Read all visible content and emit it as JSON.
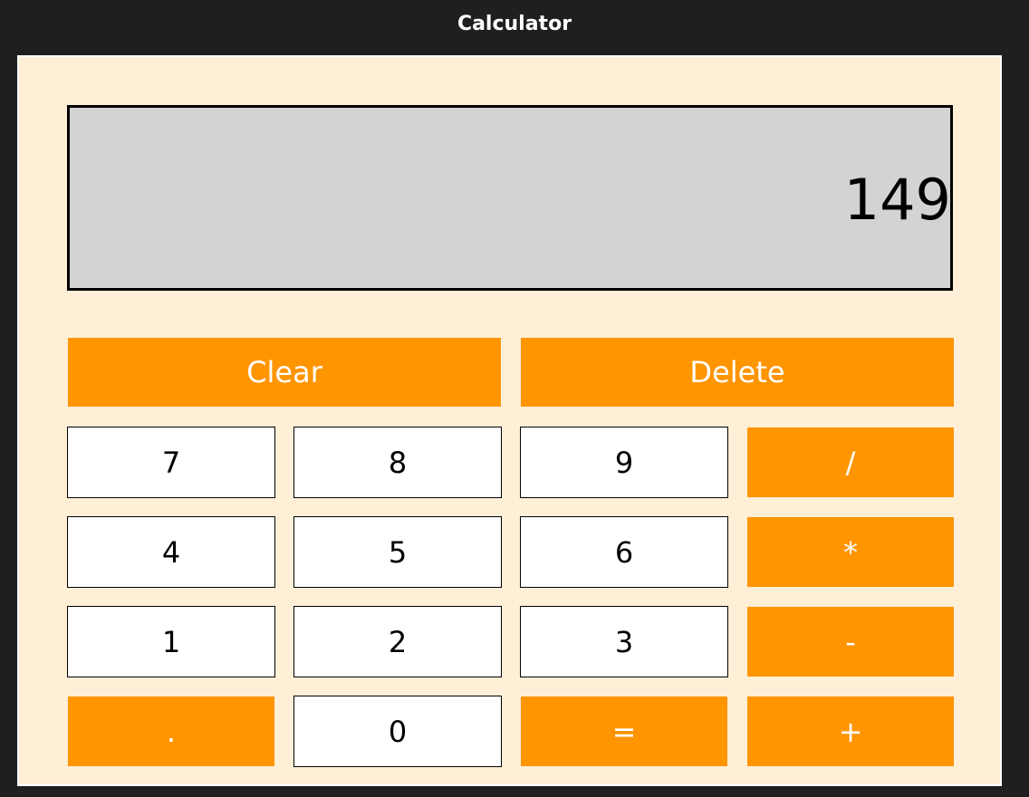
{
  "window": {
    "title": "Calculator"
  },
  "display": {
    "value": "149"
  },
  "colors": {
    "accent": "#ff9500",
    "background": "#ffefd6",
    "display_bg": "#d3d3d3",
    "titlebar_bg": "#1f1f1f"
  },
  "keys": {
    "clear": "Clear",
    "delete": "Delete",
    "seven": "7",
    "eight": "8",
    "nine": "9",
    "divide": "/",
    "four": "4",
    "five": "5",
    "six": "6",
    "multiply": "*",
    "one": "1",
    "two": "2",
    "three": "3",
    "subtract": "-",
    "decimal": ".",
    "zero": "0",
    "equals": "=",
    "add": "+"
  }
}
